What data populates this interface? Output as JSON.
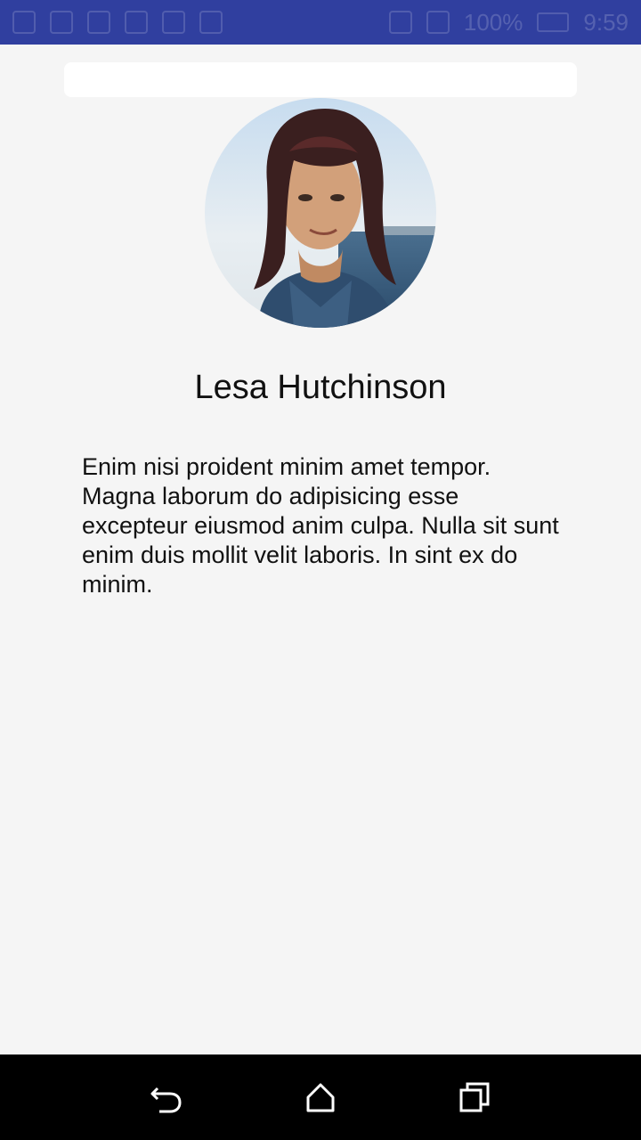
{
  "status_bar": {
    "battery_percent": "100%",
    "time": "9:59",
    "colors": {
      "background": "#303f9f"
    }
  },
  "profile": {
    "name": "Lesa Hutchinson",
    "bio": "Enim nisi proident minim amet tempor. Magna laborum do adipisicing esse excepteur eiusmod anim culpa. Nulla sit sunt enim duis mollit velit laboris. In sint ex do minim.",
    "avatar_icon": "profile-photo"
  },
  "nav_bar": {
    "items": [
      {
        "icon": "back-icon"
      },
      {
        "icon": "home-icon"
      },
      {
        "icon": "recents-icon"
      }
    ]
  }
}
